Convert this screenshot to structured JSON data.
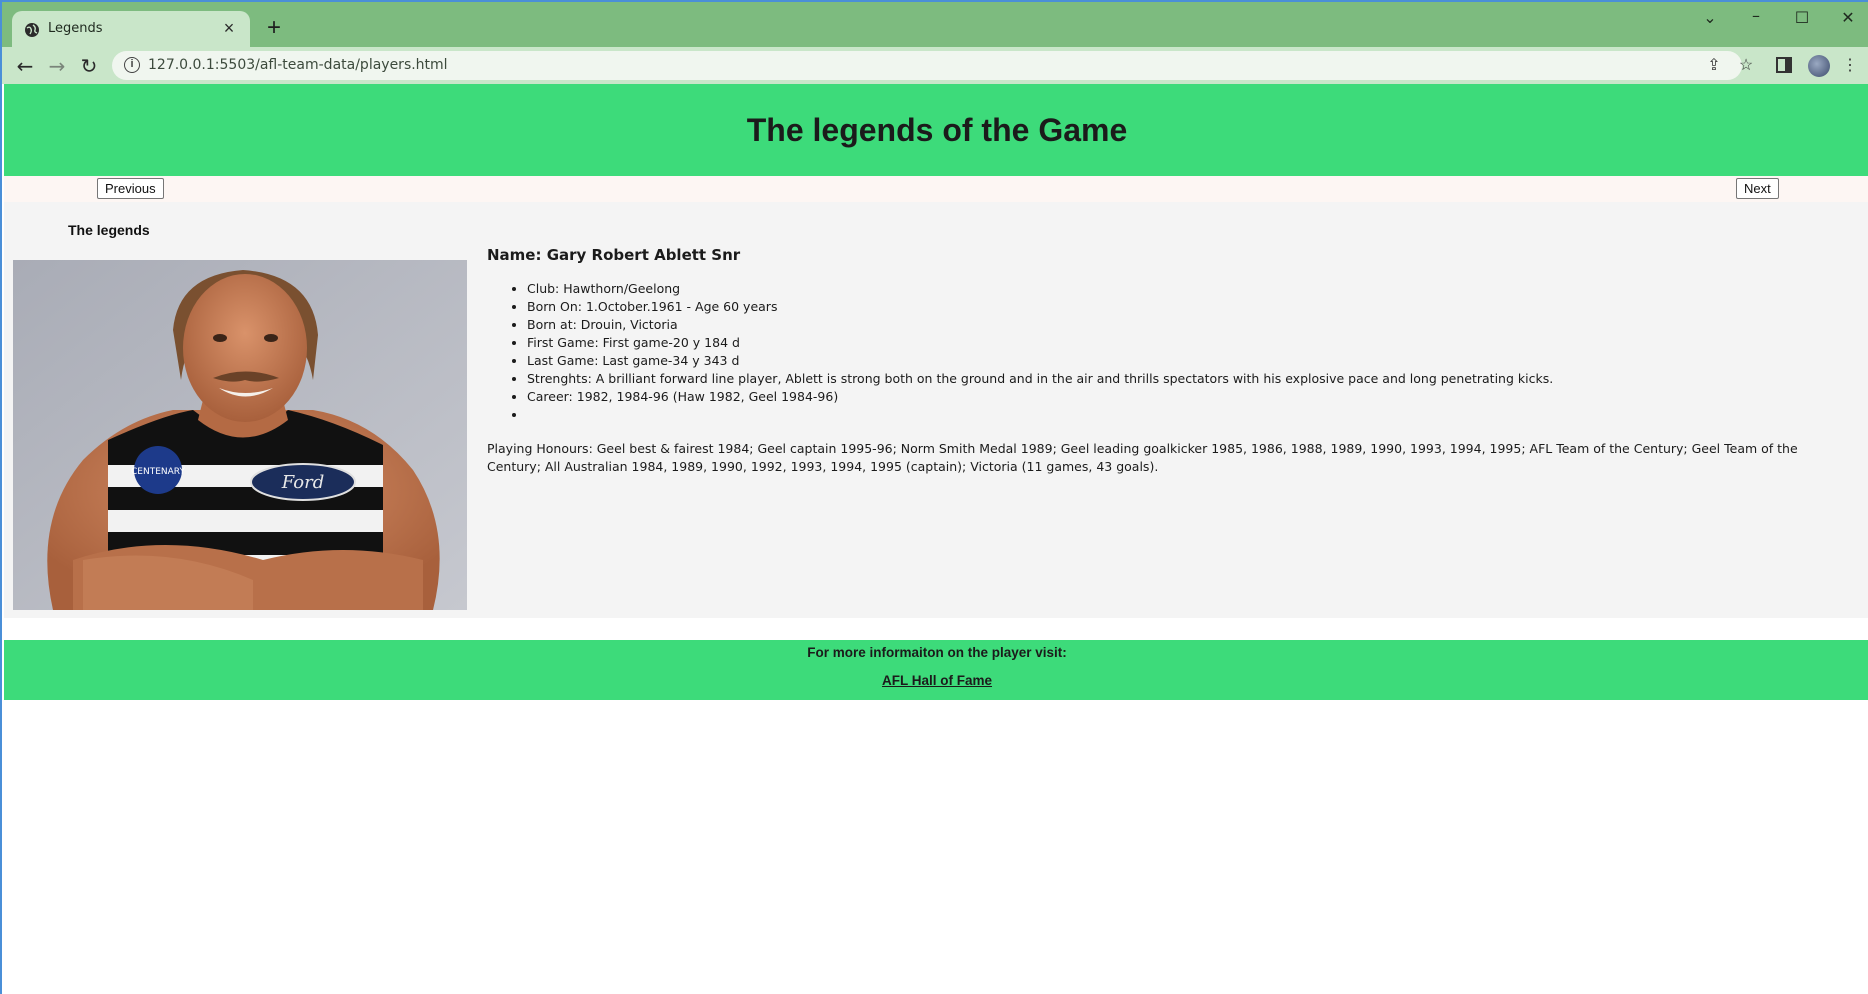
{
  "browser": {
    "tab_title": "Legends",
    "new_tab_symbol": "+",
    "url": "127.0.0.1:5503/afl-team-data/players.html",
    "icons": [
      "globe-icon",
      "close-icon",
      "back-icon",
      "forward-icon",
      "reload-icon",
      "info-icon",
      "share-icon",
      "star-icon",
      "sidebar-icon",
      "profile-avatar",
      "menu-icon",
      "tab-search-icon",
      "minimize-icon",
      "maximize-icon",
      "window-close-icon"
    ]
  },
  "header": {
    "title": "The legends of the Game",
    "color": "#3ddb7a"
  },
  "nav": {
    "previous_label": "Previous",
    "next_label": "Next"
  },
  "sidebar": {
    "title": "The legends"
  },
  "player": {
    "name": "Name: Gary Robert Ablett Snr",
    "facts": [
      "Club: Hawthorn/Geelong",
      "Born On: 1.October.1961 - Age 60 years",
      "Born at: Drouin, Victoria",
      "First Game: First game-20 y 184 d",
      "Last Game: Last game-34 y 343 d",
      "Strenghts: A brilliant forward line player, Ablett is strong both on the ground and in the air and thrills spectators with his explosive pace and long penetrating kicks.",
      "Career: 1982, 1984-96 (Haw 1982, Geel 1984-96)",
      ""
    ],
    "honours": "Playing Honours: Geel best & fairest 1984; Geel captain 1995-96; Norm Smith Medal 1989; Geel leading goalkicker 1985, 1986, 1988, 1989, 1990, 1993, 1994, 1995; AFL Team of the Century; Geel Team of the Century; All Australian 1984, 1989, 1990, 1992, 1993, 1994, 1995 (captain); Victoria (11 games, 43 goals).",
    "photo_badges": [
      "CENTENARY",
      "Ford"
    ]
  },
  "footer": {
    "lead": "For more informaiton on the player visit:",
    "link_label": "AFL Hall of Fame"
  }
}
